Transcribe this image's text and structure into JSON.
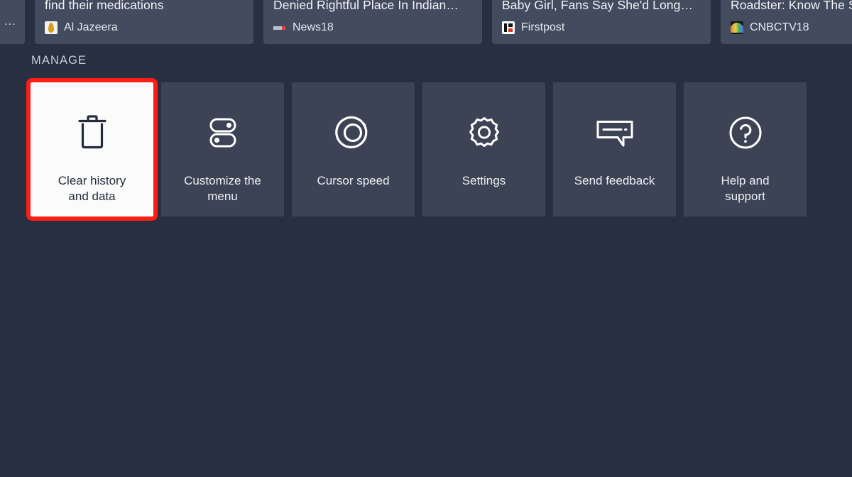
{
  "screen": {
    "background_color": "#272f40",
    "tile_color": "#3b4354",
    "selected_tile_background": "#fbfbfb",
    "selected_tile_border_color": "#fc1d15",
    "news_card_color": "#434b5e"
  },
  "news_strip": {
    "cards": [
      {
        "title": "…",
        "source": "",
        "logo": "cut-off-card-icon",
        "truncated": true
      },
      {
        "title": "In Iran, patients are struggling to\nfind their medications",
        "source": "Al Jazeera",
        "logo": "al-jazeera-logo"
      },
      {
        "title": "Subhash Chandra Bose | Netaji\nDenied Rightful Place In Indian…",
        "source": "News18",
        "logo": "news18-logo"
      },
      {
        "title": "As Priyanka And Nick Welcome A\nBaby Girl, Fans Say She'd Long…",
        "source": "Firstpost",
        "logo": "firstpost-logo"
      },
      {
        "title": "Mahindra Relaunches\nRoadster: Know The S…",
        "source": "CNBCTV18",
        "logo": "cnbctv18-logo"
      }
    ]
  },
  "manage": {
    "section_label": "MANAGE",
    "tiles": [
      {
        "label": "Clear history\nand data",
        "icon": "trash-can-icon",
        "selected": true
      },
      {
        "label": "Customize the\nmenu",
        "icon": "toggle-switches-icon",
        "selected": false
      },
      {
        "label": "Cursor speed",
        "icon": "cursor-speed-dial-icon",
        "selected": false
      },
      {
        "label": "Settings",
        "icon": "gear-icon",
        "selected": false
      },
      {
        "label": "Send feedback",
        "icon": "feedback-bubble-icon",
        "selected": false
      },
      {
        "label": "Help and\nsupport",
        "icon": "question-mark-circle-icon",
        "selected": false
      }
    ]
  }
}
